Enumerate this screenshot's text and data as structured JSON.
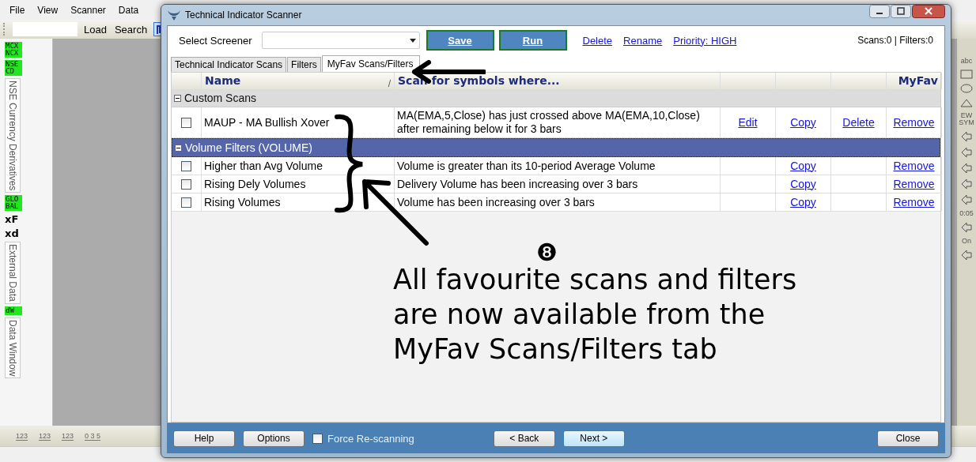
{
  "app": {
    "menu": [
      "File",
      "View",
      "Scanner",
      "Data"
    ],
    "toolbar": {
      "buttons": [
        "Load",
        "Search"
      ]
    },
    "left_panel": [
      {
        "kind": "badge",
        "text": "MCX NCX"
      },
      {
        "kind": "badge",
        "text": "NSE CD"
      },
      {
        "kind": "vertical",
        "text": "NSE Currency Derivatives"
      },
      {
        "kind": "badge",
        "text": "GLO BAL"
      },
      {
        "kind": "icon",
        "text": "xF"
      },
      {
        "kind": "icon",
        "text": "xd"
      },
      {
        "kind": "vertical",
        "text": "External Data"
      },
      {
        "kind": "badge",
        "text": "dW"
      },
      {
        "kind": "vertical",
        "text": "Data Window"
      }
    ],
    "right_toolbar": [
      {
        "kind": "text",
        "text": "abc"
      },
      {
        "kind": "rect"
      },
      {
        "kind": "ellipse"
      },
      {
        "kind": "triangle"
      },
      {
        "kind": "text",
        "text": "EW SYM"
      },
      {
        "kind": "arrow"
      },
      {
        "kind": "arrow"
      },
      {
        "kind": "arrow"
      },
      {
        "kind": "arrow"
      },
      {
        "kind": "arrow"
      },
      {
        "kind": "text",
        "text": "0:05"
      },
      {
        "kind": "arrow"
      },
      {
        "kind": "text",
        "text": "On"
      },
      {
        "kind": "arrow"
      }
    ],
    "bottom_toolbar": [
      "123",
      "123",
      "123",
      "0 3 5"
    ]
  },
  "dialog": {
    "title": "Technical Indicator Scanner",
    "screener_label": "Select Screener",
    "buttons": [
      "Save",
      "Run"
    ],
    "links": [
      "Delete",
      "Rename",
      "Priority: HIGH"
    ],
    "counts": "Scans:0 | Filters:0",
    "tabs": [
      {
        "label": "Technical Indicator Scans",
        "selected": false
      },
      {
        "label": "Filters",
        "selected": false
      },
      {
        "label": "MyFav Scans/Filters",
        "selected": true
      }
    ],
    "columns": {
      "name": "Name",
      "sort": "/",
      "scan": "Scan for symbols where...",
      "myfav": "MyFav"
    },
    "groups": [
      {
        "label": "Custom Scans",
        "expanded": true,
        "selected": false,
        "rows": [
          {
            "checked": false,
            "name": "MAUP - MA Bullish Xover",
            "scan": "MA(EMA,5,Close) has just crossed above MA(EMA,10,Close) after remaining below it for 3 bars",
            "links": {
              "edit": "Edit",
              "copy": "Copy",
              "delete": "Delete",
              "remove": "Remove"
            }
          }
        ]
      },
      {
        "label": "Volume Filters (VOLUME)",
        "expanded": true,
        "selected": true,
        "rows": [
          {
            "checked": false,
            "name": "Higher than Avg Volume",
            "scan": "Volume is greater than its 10-period Average Volume",
            "links": {
              "copy": "Copy",
              "remove": "Remove"
            }
          },
          {
            "checked": false,
            "name": "Rising Dely Volumes",
            "scan": "Delivery Volume has been increasing over 3 bars",
            "links": {
              "copy": "Copy",
              "remove": "Remove"
            }
          },
          {
            "checked": false,
            "name": "Rising Volumes",
            "scan": "Volume has been increasing over 3 bars",
            "links": {
              "copy": "Copy",
              "remove": "Remove"
            }
          }
        ]
      }
    ],
    "footer": {
      "left": [
        {
          "label": "Help",
          "focused": false
        },
        {
          "label": "Options",
          "focused": false
        }
      ],
      "checkbox": {
        "label": "Force Re-scanning",
        "checked": false
      },
      "middle": [
        {
          "label": "< Back",
          "focused": false
        },
        {
          "label": "Next >",
          "focused": true
        }
      ],
      "right": [
        {
          "label": "Close",
          "focused": false
        }
      ]
    }
  },
  "annotation": {
    "number": "❽",
    "lines": [
      "All favourite scans and filters",
      "are now available from the",
      "MyFav Scans/Filters tab"
    ]
  }
}
